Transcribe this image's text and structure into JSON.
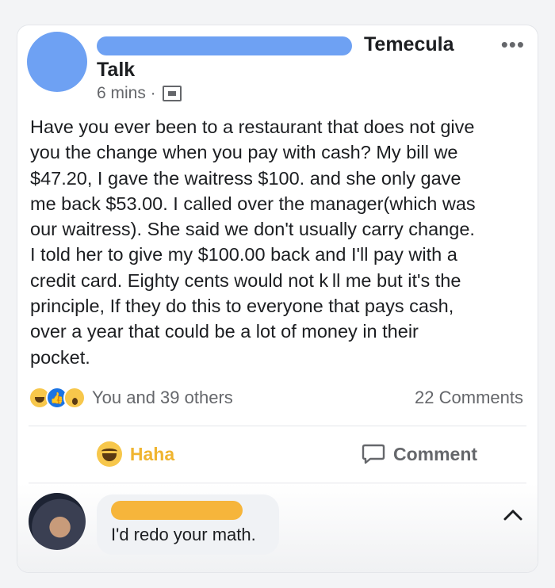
{
  "post": {
    "group_name": "Temecula",
    "group_name_2": "Talk",
    "time": "6 mins ·",
    "text": "Have you ever been to a restaurant that does not give\nyou the change when you pay with cash? My bill we\n$47.20, I gave the waitress $100. and she only gave\nme back $53.00. I called over the manager(which was\nour waitress). She said we don't usually carry change.\nI told her to give my $100.00 back and I'll pay with a\ncredit card. Eighty cents would not k ll me but it's the\nprinciple, If they do this to everyone that pays cash,\nover a year that could be a lot of money in their\npocket."
  },
  "reactions": {
    "icons": [
      "haha-icon",
      "like-icon",
      "wow-icon"
    ],
    "text": "You and 39 others",
    "comments_count": "22 Comments"
  },
  "actions": {
    "haha_label": "Haha",
    "comment_label": "Comment"
  },
  "comment": {
    "text": "I'd redo your math."
  },
  "colors": {
    "redaction_blue": "#6ea1f3",
    "redaction_orange": "#f6b53b",
    "haha_accent": "#f0b530"
  }
}
